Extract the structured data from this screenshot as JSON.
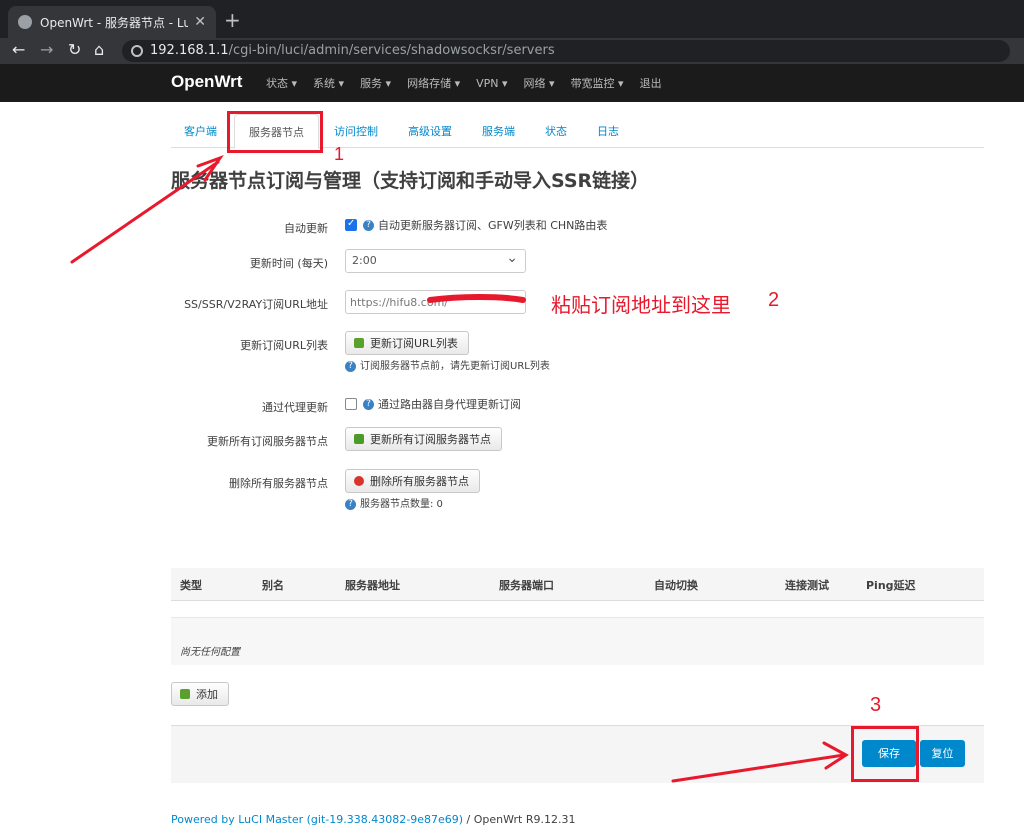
{
  "browser": {
    "tab_title": "OpenWrt - 服务器节点 - LuCI",
    "url_host": "192.168.1.1",
    "url_path": "/cgi-bin/luci/admin/services/shadowsocksr/servers"
  },
  "header": {
    "brand": "OpenWrt",
    "menu": [
      "状态 ▾",
      "系统 ▾",
      "服务 ▾",
      "网络存储 ▾",
      "VPN ▾",
      "网络 ▾",
      "带宽监控 ▾",
      "退出"
    ]
  },
  "tabs": [
    "客户端",
    "服务器节点",
    "访问控制",
    "高级设置",
    "服务端",
    "状态",
    "日志"
  ],
  "page_title": "服务器节点订阅与管理（支持订阅和手动导入SSR链接）",
  "form": {
    "auto_update": {
      "label": "自动更新",
      "checked": true,
      "note": "自动更新服务器订阅、GFW列表和 CHN路由表"
    },
    "update_time": {
      "label": "更新时间 (每天)",
      "value": "2:00"
    },
    "sub_url": {
      "label": "SS/SSR/V2RAY订阅URL地址",
      "value": "https://hifu8.com/"
    },
    "update_url_list": {
      "label": "更新订阅URL列表",
      "button": "更新订阅URL列表",
      "hint": "订阅服务器节点前，请先更新订阅URL列表"
    },
    "via_proxy": {
      "label": "通过代理更新",
      "checked": false,
      "note": "通过路由器自身代理更新订阅"
    },
    "update_all": {
      "label": "更新所有订阅服务器节点",
      "button": "更新所有订阅服务器节点"
    },
    "delete_all": {
      "label": "删除所有服务器节点",
      "button": "删除所有服务器节点",
      "hint": "服务器节点数量: 0"
    }
  },
  "table": {
    "headers": [
      "类型",
      "别名",
      "服务器地址",
      "服务器端口",
      "自动切换",
      "连接测试",
      "Ping延迟"
    ],
    "empty": "尚无任何配置"
  },
  "actions": {
    "add": "添加",
    "save": "保存",
    "reset": "复位"
  },
  "footer": {
    "link": "Powered by LuCI Master (git-19.338.43082-9e87e69)",
    "sep": " / ",
    "version": "OpenWrt R9.12.31"
  },
  "annotations": {
    "step1": "1",
    "step2": "2",
    "step3": "3",
    "paste_hint": "粘贴订阅地址到这里"
  },
  "colors": {
    "accent": "#0088cc",
    "annotation": "#e8192c",
    "header_bg": "#1b1b1b"
  }
}
